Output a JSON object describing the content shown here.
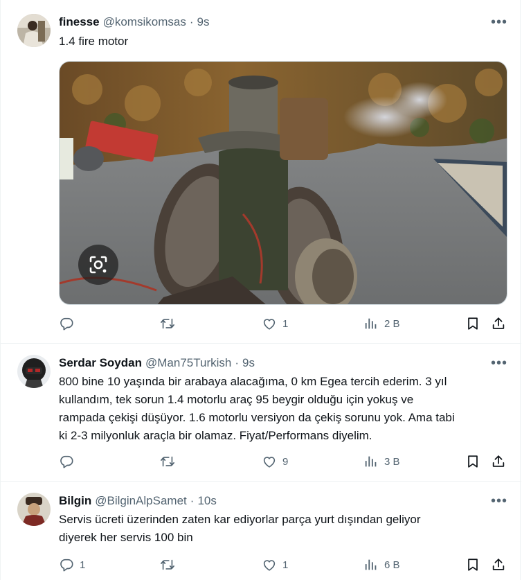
{
  "tweets": [
    {
      "name": "finesse",
      "handle": "@komsikomsas",
      "dot": "·",
      "time": "9s",
      "text": "1.4 fire motor",
      "more": "•••",
      "reply_count": "",
      "retweet_count": "",
      "like_count": "1",
      "view_count": "2 B"
    },
    {
      "name": "Serdar Soydan",
      "handle": "@Man75Turkish",
      "dot": "·",
      "time": "9s",
      "text": "800 bine 10 yaşında bir arabaya alacağıma, 0 km Egea tercih ederim. 3 yıl\nkullandım, tek sorun 1.4 motorlu araç 95 beygir olduğu için yokuş ve\nrampada çekişi düşüyor. 1.6 motorlu versiyon da çekiş sorunu yok. Ama tabi\nki 2-3 milyonluk araçla bir olamaz. Fiyat/Performans diyelim.",
      "more": "•••",
      "reply_count": "",
      "retweet_count": "",
      "like_count": "9",
      "view_count": "3 B"
    },
    {
      "name": "Bilgin",
      "handle": "@BilginAlpSamet",
      "dot": "·",
      "time": "10s",
      "text": "Servis ücreti üzerinden zaten kar ediyorlar parça yurt dışından geliyor\ndiyerek her servis 100 bin",
      "more": "•••",
      "reply_count": "1",
      "retweet_count": "",
      "like_count": "1",
      "view_count": "6 B"
    }
  ],
  "icons": {
    "reply": "reply-icon",
    "retweet": "retweet-icon",
    "like": "like-icon",
    "views": "views-icon",
    "bookmark": "bookmark-icon",
    "share": "share-icon",
    "lens": "visual-search-icon"
  },
  "colors": {
    "text_primary": "#0f1419",
    "text_secondary": "#536471",
    "divider": "#eff3f4"
  }
}
